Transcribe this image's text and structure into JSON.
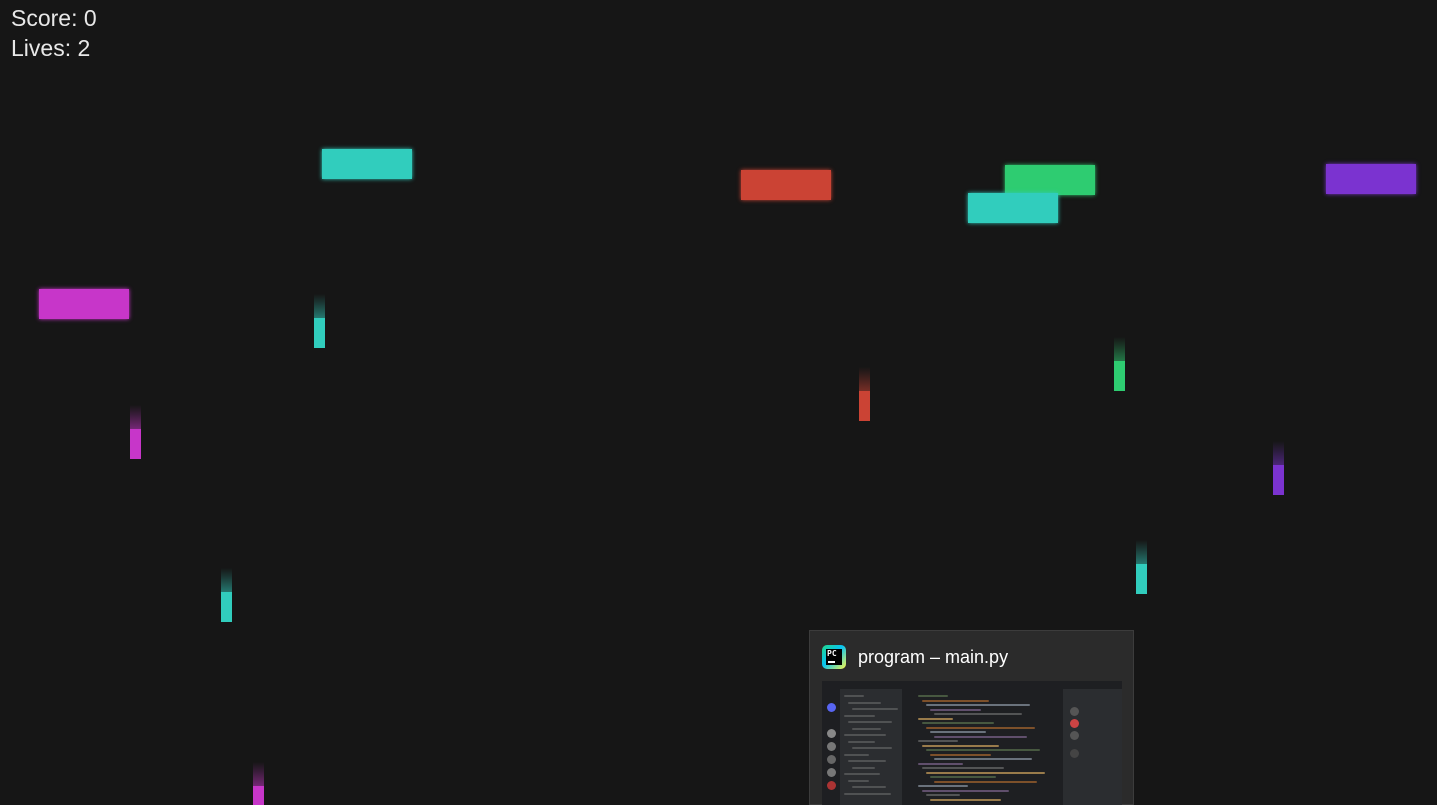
{
  "hud": {
    "score_label": "Score: 0",
    "lives_label": "Lives: 2"
  },
  "colors": {
    "background": "#161616",
    "hud_text": "#e8e8e8",
    "cyan": "#31cdbd",
    "red": "#cb4334",
    "green": "#2ecc71",
    "purple": "#7b33d0",
    "magenta": "#c736c9"
  },
  "paddles": [
    {
      "color": "cyan"
    },
    {
      "color": "red"
    },
    {
      "color": "green"
    },
    {
      "color": "cyan"
    },
    {
      "color": "purple"
    },
    {
      "color": "magenta"
    }
  ],
  "drops": [
    {
      "color": "cyan"
    },
    {
      "color": "magenta"
    },
    {
      "color": "red"
    },
    {
      "color": "green"
    },
    {
      "color": "purple"
    },
    {
      "color": "cyan"
    },
    {
      "color": "cyan"
    },
    {
      "color": "magenta"
    }
  ],
  "taskbar_preview": {
    "app_icon": "pycharm-icon",
    "icon_text": "PC",
    "title": "program – main.py"
  }
}
